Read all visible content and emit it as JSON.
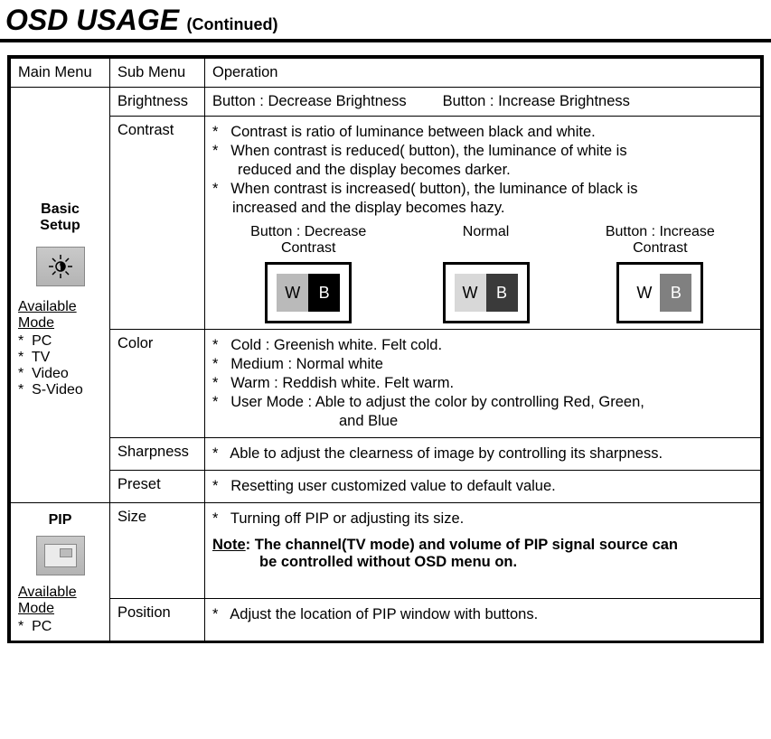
{
  "title": {
    "main": "OSD USAGE",
    "sub": "(Continued)"
  },
  "headers": {
    "main_menu": "Main Menu",
    "sub_menu": "Sub Menu",
    "operation": "Operation"
  },
  "basic_setup": {
    "title1": "Basic",
    "title2": "Setup",
    "available_label": "Available Mode",
    "modes": [
      "PC",
      "TV",
      "Video",
      "S-Video"
    ]
  },
  "brightness": {
    "label": "Brightness",
    "dec": "Button : Decrease Brightness",
    "inc": "Button : Increase Brightness"
  },
  "contrast": {
    "label": "Contrast",
    "b1": "Contrast is ratio of luminance between black and white.",
    "b2a": "When contrast is reduced(  button), the luminance of white is",
    "b2b": "reduced and the display becomes darker.",
    "b3a": "When contrast is increased( button), the luminance of black is",
    "b3b": "increased  and the display becomes hazy.",
    "demo_dec1": "Button : Decrease",
    "demo_dec2": "Contrast",
    "demo_norm": "Normal",
    "demo_inc1": "Button : Increase",
    "demo_inc2": "Contrast",
    "W": "W",
    "B": "B"
  },
  "color": {
    "label": "Color",
    "b1": "Cold : Greenish white. Felt cold.",
    "b2": "Medium : Normal white",
    "b3": "Warm : Reddish white. Felt warm.",
    "b4a": "User Mode : Able to adjust the color by controlling Red, Green,",
    "b4b": "and Blue"
  },
  "sharpness": {
    "label": "Sharpness",
    "b1": "Able to adjust the clearness of image by controlling its sharpness."
  },
  "preset": {
    "label": "Preset",
    "b1": "Resetting user customized value to default value."
  },
  "pip": {
    "title": "PIP",
    "available_label": "Available Mode",
    "modes": [
      "PC"
    ],
    "size": {
      "label": "Size",
      "b1": "Turning off PIP or adjusting its size.",
      "note_label": "Note",
      "note1": ": The channel(TV mode) and volume of PIP signal source can",
      "note2": "be controlled without OSD menu on."
    },
    "position": {
      "label": "Position",
      "b1": "Adjust the location of PIP window with buttons."
    }
  }
}
